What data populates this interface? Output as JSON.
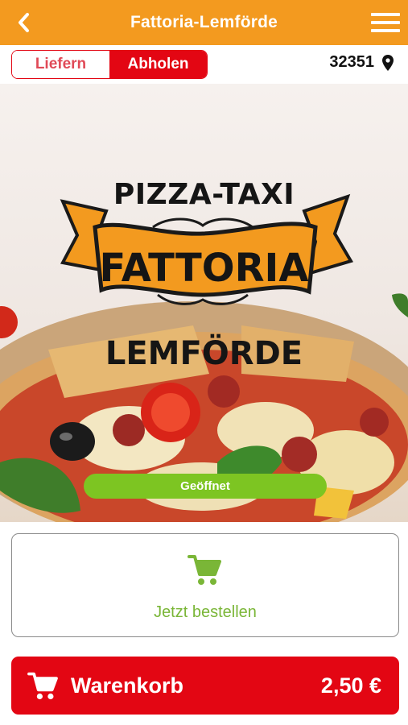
{
  "header": {
    "title": "Fattoria-Lemförde",
    "back_icon": "chevron-left-icon",
    "menu_icon": "hamburger-menu-icon"
  },
  "mode": {
    "options": [
      "Liefern",
      "Abholen"
    ],
    "selected": "Abholen"
  },
  "location": {
    "zip": "32351",
    "icon": "map-pin-icon"
  },
  "hero": {
    "logo_line1": "PIZZA-TAXI",
    "logo_line2": "FATTORIA",
    "logo_line3": "LEMFÖRDE",
    "status": "Geöffnet"
  },
  "order": {
    "label": "Jetzt bestellen",
    "icon": "shopping-cart-icon"
  },
  "cart": {
    "label": "Warenkorb",
    "total": "2,50 €",
    "icon": "shopping-cart-icon"
  },
  "colors": {
    "header": "#f39a1f",
    "brand_red": "#e30613",
    "open_green": "#7dc522",
    "order_green": "#7ab637"
  }
}
